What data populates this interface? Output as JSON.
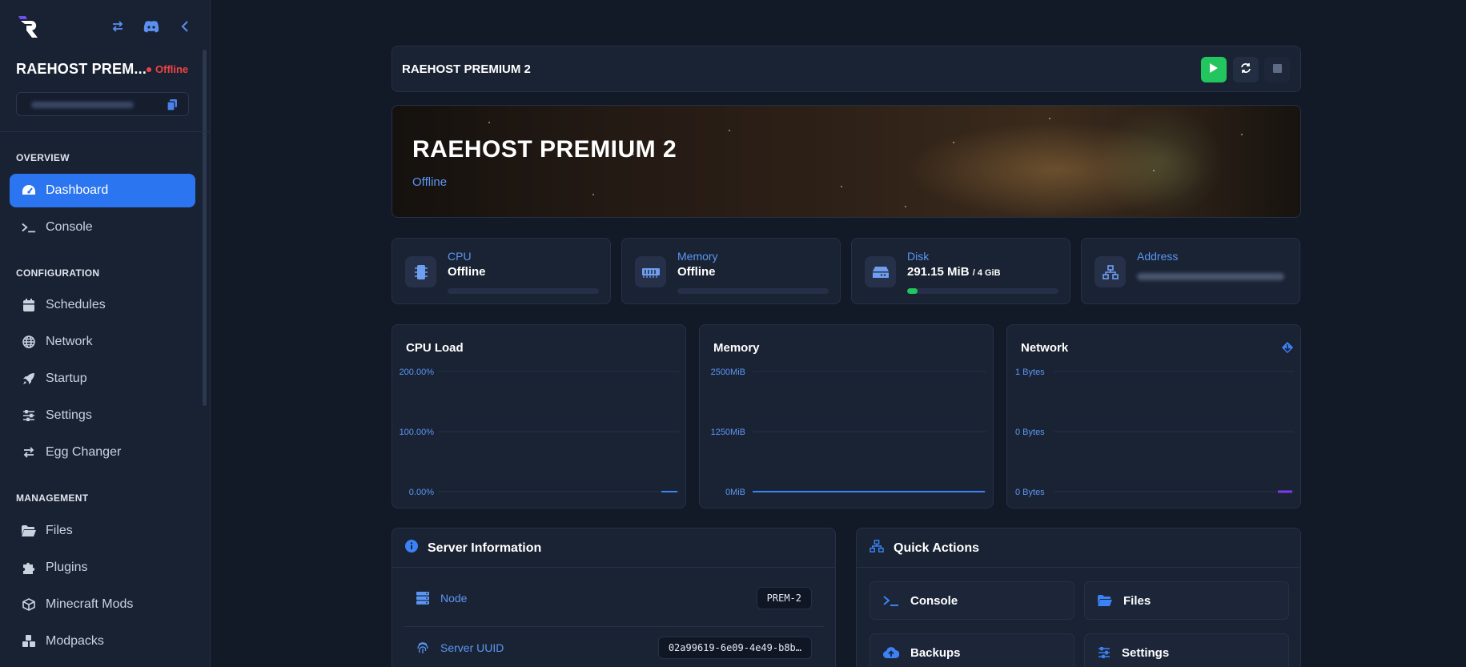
{
  "sidebar": {
    "server_name": "RAEHOST PREM...",
    "server_status": "Offline",
    "sections": {
      "overview": "OVERVIEW",
      "configuration": "CONFIGURATION",
      "management": "MANAGEMENT"
    },
    "items": [
      {
        "label": "Dashboard",
        "icon": "dashboard-icon"
      },
      {
        "label": "Console",
        "icon": "terminal-icon"
      },
      {
        "label": "Schedules",
        "icon": "calendar-icon"
      },
      {
        "label": "Network",
        "icon": "globe-icon"
      },
      {
        "label": "Startup",
        "icon": "rocket-icon"
      },
      {
        "label": "Settings",
        "icon": "sliders-icon"
      },
      {
        "label": "Egg Changer",
        "icon": "swap-icon"
      },
      {
        "label": "Files",
        "icon": "folder-icon"
      },
      {
        "label": "Plugins",
        "icon": "puzzle-icon"
      },
      {
        "label": "Minecraft Mods",
        "icon": "cube-icon"
      },
      {
        "label": "Modpacks",
        "icon": "cubes-icon"
      }
    ]
  },
  "header": {
    "title": "RAEHOST PREMIUM 2"
  },
  "banner": {
    "title": "RAEHOST PREMIUM 2",
    "status": "Offline"
  },
  "stats": {
    "cpu": {
      "label": "CPU",
      "value": "Offline"
    },
    "memory": {
      "label": "Memory",
      "value": "Offline"
    },
    "disk": {
      "label": "Disk",
      "value": "291.15 MiB",
      "limit": "/ 4 GiB",
      "usage_fraction": 0.07
    },
    "address": {
      "label": "Address"
    }
  },
  "charts": {
    "cpu": {
      "title": "CPU Load",
      "ticks": [
        "200.00%",
        "100.00%",
        "0.00%"
      ]
    },
    "memory": {
      "title": "Memory",
      "ticks": [
        "2500MiB",
        "1250MiB",
        "0MiB"
      ]
    },
    "network": {
      "title": "Network",
      "ticks": [
        "1 Bytes",
        "0 Bytes",
        "0 Bytes"
      ]
    }
  },
  "chart_data": [
    {
      "type": "line",
      "title": "CPU Load",
      "ylim": [
        0,
        200
      ],
      "ytick_labels": [
        "200.00%",
        "100.00%",
        "0.00%"
      ],
      "series": [
        {
          "values": [
            0,
            0,
            0,
            0,
            0
          ]
        }
      ]
    },
    {
      "type": "line",
      "title": "Memory",
      "ylim": [
        0,
        2500
      ],
      "ytick_labels": [
        "2500MiB",
        "1250MiB",
        "0MiB"
      ],
      "series": [
        {
          "values": [
            0,
            0,
            0,
            0,
            0
          ]
        }
      ]
    },
    {
      "type": "line",
      "title": "Network",
      "ytick_labels": [
        "1 Bytes",
        "0 Bytes",
        "0 Bytes"
      ],
      "series": [
        {
          "values": [
            0,
            0,
            0,
            0,
            0
          ]
        },
        {
          "values": [
            0,
            0,
            0,
            0,
            0
          ]
        }
      ]
    }
  ],
  "server_info": {
    "title": "Server Information",
    "rows": [
      {
        "label": "Node",
        "value": "PREM-2"
      },
      {
        "label": "Server UUID",
        "value": "02a99619-6e09-4e49-b8b…"
      }
    ]
  },
  "quick_actions": {
    "title": "Quick Actions",
    "items": [
      {
        "label": "Console"
      },
      {
        "label": "Files"
      },
      {
        "label": "Backups"
      },
      {
        "label": "Settings"
      }
    ]
  },
  "colors": {
    "accent": "#2b76f0",
    "offline": "#ef4444",
    "online": "#22c55e",
    "background": "#121a28"
  }
}
